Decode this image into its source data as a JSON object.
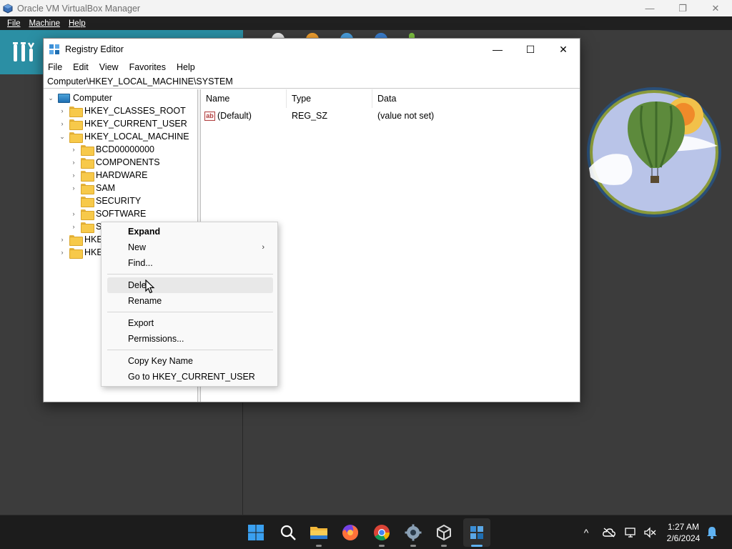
{
  "host": {
    "title": "Oracle VM VirtualBox Manager",
    "menu": [
      "File",
      "Machine",
      "Help"
    ],
    "controls": {
      "minimize": "—",
      "maximize": "❐",
      "close": "✕"
    }
  },
  "regedit": {
    "title": "Registry Editor",
    "controls": {
      "minimize": "—",
      "maximize": "☐",
      "close": "✕"
    },
    "menu": [
      "File",
      "Edit",
      "View",
      "Favorites",
      "Help"
    ],
    "address": "Computer\\HKEY_LOCAL_MACHINE\\SYSTEM",
    "tree": {
      "root": "Computer",
      "hives": [
        "HKEY_CLASSES_ROOT",
        "HKEY_CURRENT_USER",
        "HKEY_LOCAL_MACHINE"
      ],
      "hklm_children": [
        "BCD00000000",
        "COMPONENTS",
        "HARDWARE",
        "SAM",
        "SECURITY",
        "SOFTWARE",
        "S"
      ],
      "trailing": [
        "HKE",
        "HKE"
      ]
    },
    "columns": [
      "Name",
      "Type",
      "Data"
    ],
    "values": [
      {
        "name": "(Default)",
        "type": "REG_SZ",
        "data": "(value not set)",
        "icon": "ab"
      }
    ]
  },
  "context_menu": {
    "items": {
      "expand": "Expand",
      "new": "New",
      "find": "Find...",
      "delete": "Dele",
      "rename": "Rename",
      "export": "Export",
      "permissions": "Permissions...",
      "copy_key": "Copy Key Name",
      "goto": "Go to HKEY_CURRENT_USER"
    },
    "new_arrow": "›"
  },
  "taskbar": {
    "icons": [
      "start-icon",
      "search-icon",
      "file-explorer-icon",
      "firefox-icon",
      "chrome-icon",
      "settings-icon",
      "virtualbox-icon",
      "registry-editor-icon"
    ],
    "tray": {
      "chevron": "^",
      "time": "1:27 AM",
      "date": "2/6/2024"
    }
  },
  "colors": {
    "vbox_accent": "#2b8fa4",
    "taskbar": "#1c1c1c",
    "selection": "#e8e8e8"
  }
}
